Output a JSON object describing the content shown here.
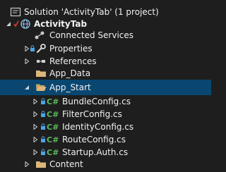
{
  "solution": {
    "label": "Solution 'ActivityTab' (1 project)"
  },
  "project": {
    "label": "ActivityTab"
  },
  "nodes": {
    "connected_services": "Connected Services",
    "properties": "Properties",
    "references": "References",
    "app_data": "App_Data",
    "app_start": "App_Start",
    "bundle_config": "BundleConfig.cs",
    "filter_config": "FilterConfig.cs",
    "identity_config": "IdentityConfig.cs",
    "route_config": "RouteConfig.cs",
    "startup_auth": "Startup.Auth.cs",
    "content": "Content"
  },
  "colors": {
    "background": "#1e1e1e",
    "selection": "#094771",
    "text": "#f1f1f1",
    "csharp": "#5cb85c",
    "folder": "#dcb67a",
    "lock": "#4fa3e0",
    "check": "#e03c3c"
  },
  "icons": {
    "solution": "solution-icon",
    "project": "web-project-icon",
    "connected_services": "connected-services-icon",
    "properties": "wrench-icon",
    "references": "references-icon",
    "folder": "folder-icon",
    "folder_open": "folder-open-icon",
    "csharp": "csharp-file-icon"
  }
}
